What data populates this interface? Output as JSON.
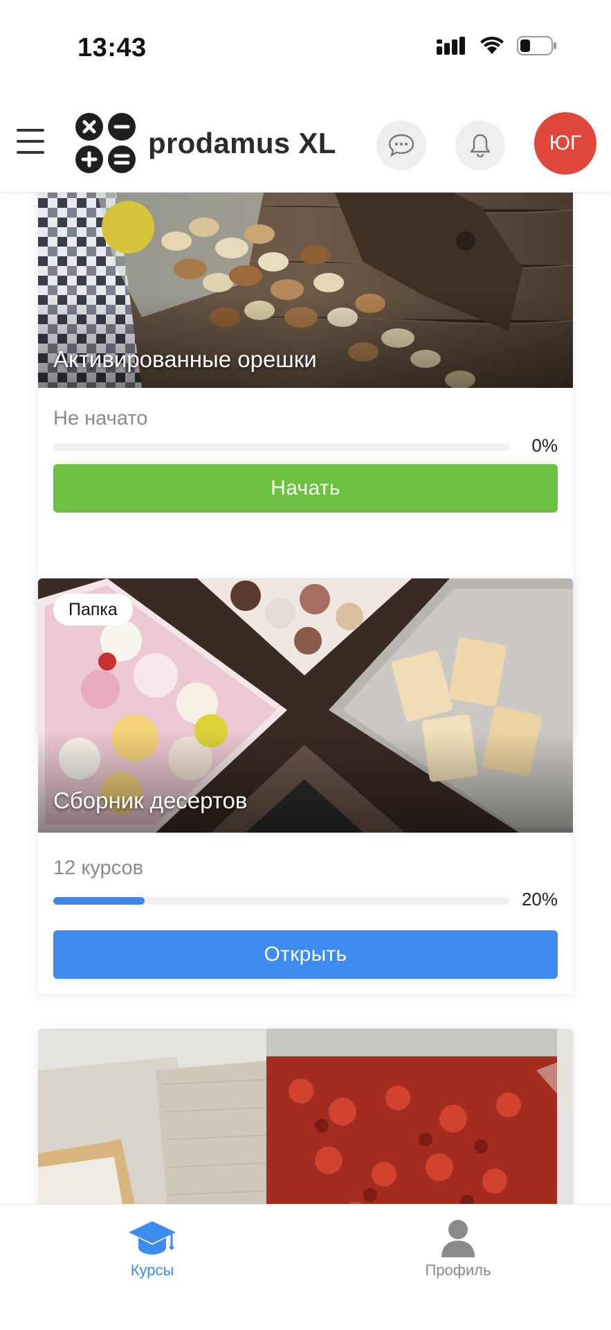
{
  "status_bar": {
    "time": "13:43"
  },
  "header": {
    "logo_text": "prodamus XL",
    "avatar_initials": "ЮГ"
  },
  "cards": [
    {
      "title": "Активированные орешки",
      "meta": "Не начато",
      "progress": 0,
      "progress_label": "0%",
      "button_label": "Начать",
      "button_color": "#6cc240"
    },
    {
      "badge": "Папка",
      "title": "Сборник десертов",
      "meta": "12 курсов",
      "progress": 0.2,
      "progress_label": "20%",
      "button_label": "Открыть",
      "button_color": "#3d8bef"
    },
    {
      "title": ""
    }
  ],
  "bottom_nav": {
    "items": [
      {
        "label": "Курсы",
        "icon": "graduation-cap-icon",
        "active": true
      },
      {
        "label": "Профиль",
        "icon": "person-icon",
        "active": false
      }
    ]
  },
  "colors": {
    "accent_blue": "#3d8bef",
    "accent_green": "#6cc240",
    "avatar_red": "#e0473c"
  }
}
